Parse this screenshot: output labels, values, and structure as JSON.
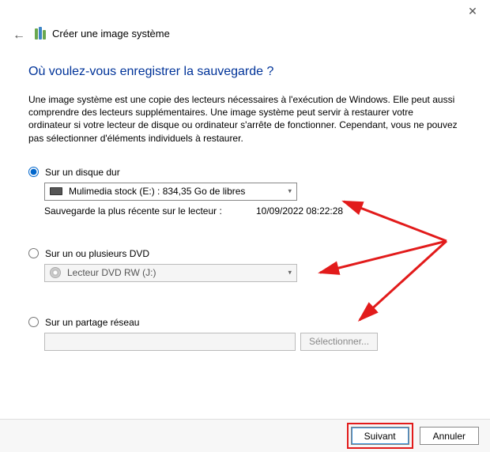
{
  "window": {
    "title": "Créer une image système"
  },
  "page": {
    "heading": "Où voulez-vous enregistrer la sauvegarde ?",
    "description": "Une image système est une copie des lecteurs nécessaires à l'exécution de Windows. Elle peut aussi comprendre des lecteurs supplémentaires. Une image système peut servir à restaurer votre ordinateur si votre lecteur de disque ou ordinateur s'arrête de fonctionner. Cependant, vous ne pouvez pas sélectionner d'éléments individuels à restaurer."
  },
  "options": {
    "hdd": {
      "label": "Sur un disque dur",
      "selected_drive": "Mulimedia stock (E:) : 834,35 Go de libres",
      "last_backup_label": "Sauvegarde la plus récente sur le lecteur :",
      "last_backup_value": "10/09/2022 08:22:28"
    },
    "dvd": {
      "label": "Sur un ou plusieurs DVD",
      "selected_drive": "Lecteur DVD RW (J:)"
    },
    "network": {
      "label": "Sur un partage réseau",
      "path": "",
      "browse_button": "Sélectionner..."
    }
  },
  "footer": {
    "next": "Suivant",
    "cancel": "Annuler"
  }
}
